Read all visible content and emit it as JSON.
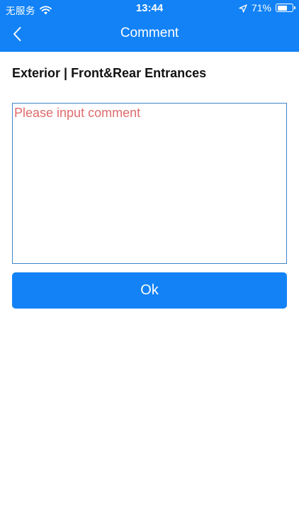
{
  "status_bar": {
    "carrier": "无服务",
    "time": "13:44",
    "battery_percent": "71%",
    "battery_level": 0.71,
    "icons": [
      "wifi-icon",
      "location-arrow-icon",
      "battery-icon"
    ]
  },
  "nav": {
    "title": "Comment",
    "back_icon": "chevron-left-icon"
  },
  "section": {
    "title": "Exterior | Front&Rear Entrances"
  },
  "comment": {
    "placeholder": "Please input comment",
    "value": ""
  },
  "actions": {
    "ok_label": "Ok"
  },
  "colors": {
    "primary": "#1282f6",
    "placeholder": "#e06b6b",
    "input_border": "#3f86c8"
  }
}
